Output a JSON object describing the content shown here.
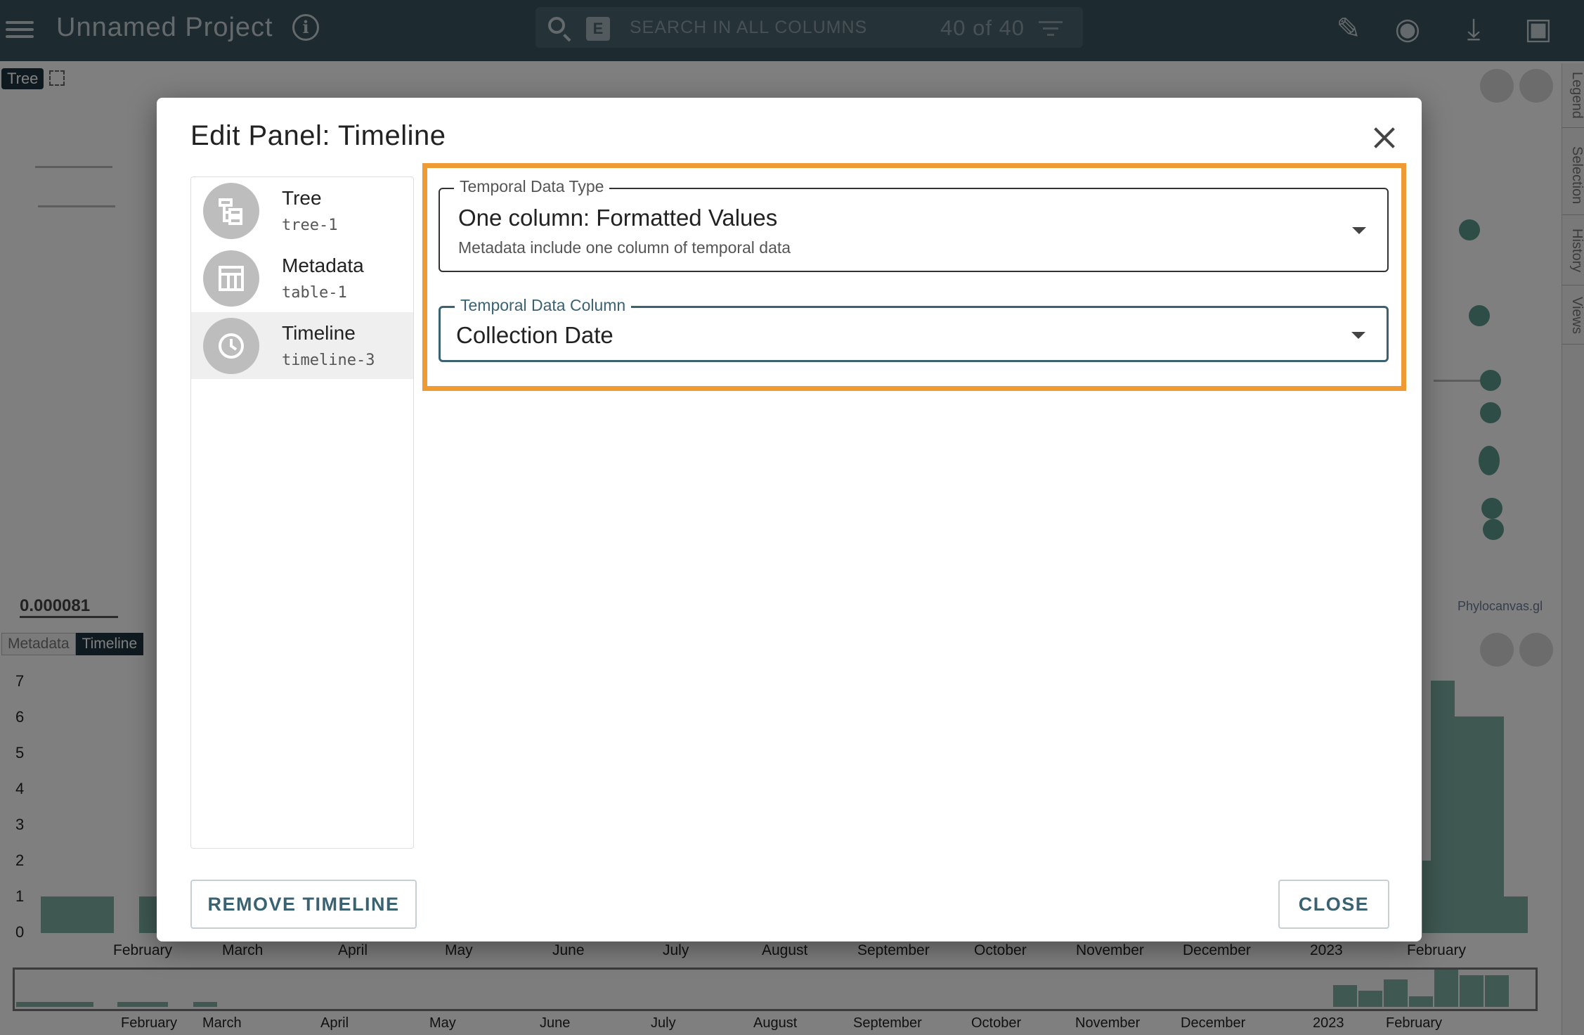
{
  "app": {
    "title": "Unnamed Project"
  },
  "search": {
    "placeholder": "SEARCH IN ALL COLUMNS",
    "regex_label": "E",
    "count": "40 of 40"
  },
  "tree_panel": {
    "tag": "Tree",
    "scale": "0.000081",
    "logo": "Phylocanvas.gl"
  },
  "right_sidebar": {
    "tabs": [
      "Legend",
      "Selection",
      "History",
      "Views"
    ]
  },
  "bottom_panel": {
    "tabs": [
      "Metadata",
      "Timeline"
    ]
  },
  "timeline_chart": {
    "y_ticks": [
      "7",
      "6",
      "5",
      "4",
      "3",
      "2",
      "1",
      "0"
    ],
    "x_ticks": [
      "February",
      "March",
      "April",
      "May",
      "June",
      "July",
      "August",
      "September",
      "October",
      "November",
      "December",
      "2023",
      "February"
    ],
    "brush_ticks": [
      "February",
      "March",
      "April",
      "May",
      "June",
      "July",
      "August",
      "September",
      "October",
      "November",
      "December",
      "2023",
      "February"
    ]
  },
  "dialog": {
    "title": "Edit Panel: Timeline",
    "panels": [
      {
        "title": "Tree",
        "id": "tree-1",
        "icon": "tree-icon"
      },
      {
        "title": "Metadata",
        "id": "table-1",
        "icon": "table-icon"
      },
      {
        "title": "Timeline",
        "id": "timeline-3",
        "icon": "clock-icon"
      }
    ],
    "selected_panel": "Timeline",
    "temporal_type": {
      "label": "Temporal Data Type",
      "value": "One column: Formatted Values",
      "secondary": "Metadata include one column of temporal data"
    },
    "temporal_column": {
      "label": "Temporal Data Column",
      "value": "Collection Date"
    },
    "remove_button": "REMOVE TIMELINE",
    "close_button": "CLOSE"
  },
  "colors": {
    "topbar": "#3a5560",
    "highlight": "#f09a33",
    "bars": "#7fb0a4",
    "accent": "#3a6270"
  }
}
